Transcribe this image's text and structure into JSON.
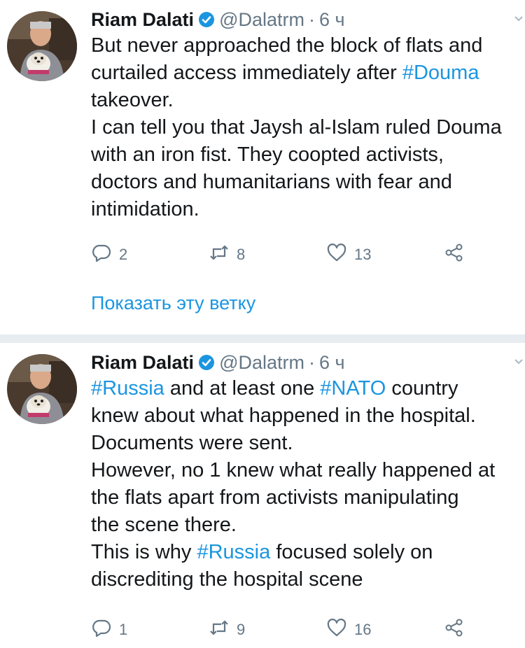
{
  "colors": {
    "accent": "#1b95e0",
    "secondary_text": "#657786",
    "primary_text": "#14171a",
    "separator": "#e6ecf0"
  },
  "icons": {
    "verified": "verified-badge-icon",
    "reply": "reply-icon",
    "retweet": "retweet-icon",
    "like": "heart-icon",
    "share": "share-icon",
    "menu": "chevron-down-icon"
  },
  "tweets": [
    {
      "name": "Riam Dalati",
      "handle": "@Dalatrm",
      "sep": "·",
      "time": "6 ч",
      "text": [
        {
          "t": "But never approached the block of flats and\ncurtailed access immediately after "
        },
        {
          "t": "#Douma",
          "hashtag": true
        },
        {
          "t": "\ntakeover.\nI can tell you that Jaysh al-Islam ruled Douma\nwith an iron fist. They coopted activists,\ndoctors and humanitarians with fear and\nintimidation."
        }
      ],
      "replies": "2",
      "retweets": "8",
      "likes": "13",
      "thread_link": "Показать эту ветку"
    },
    {
      "name": "Riam Dalati",
      "handle": "@Dalatrm",
      "sep": "·",
      "time": "6 ч",
      "text": [
        {
          "t": "#Russia",
          "hashtag": true
        },
        {
          "t": " and at least one "
        },
        {
          "t": "#NATO",
          "hashtag": true
        },
        {
          "t": " country\nknew about what happened in the hospital.\nDocuments were sent.\nHowever, no 1 knew what really happened at\nthe flats apart from activists manipulating\nthe scene there.\nThis is why "
        },
        {
          "t": "#Russia",
          "hashtag": true
        },
        {
          "t": " focused solely on\ndiscrediting the hospital scene"
        }
      ],
      "replies": "1",
      "retweets": "9",
      "likes": "16"
    }
  ]
}
